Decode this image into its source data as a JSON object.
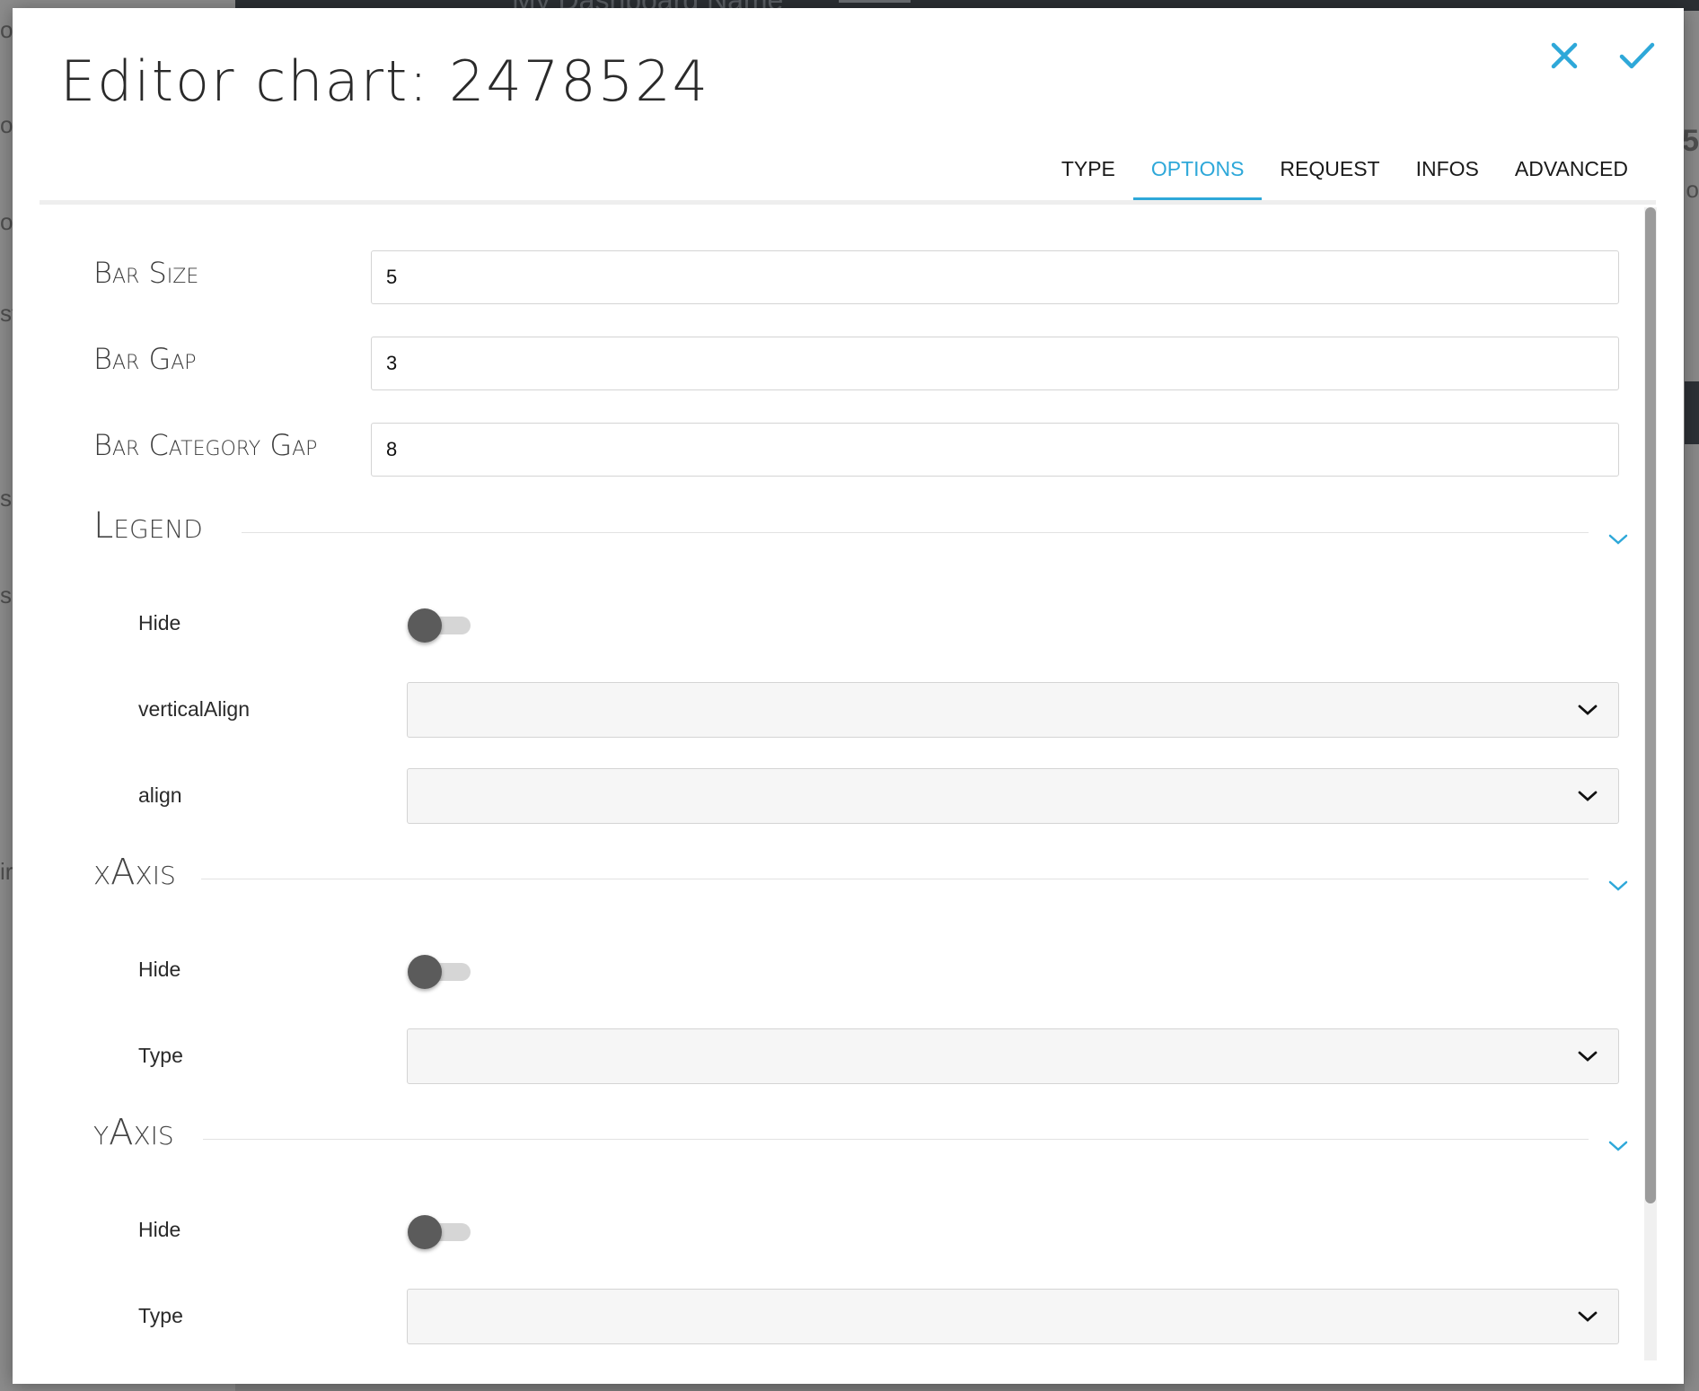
{
  "background": {
    "dashboard_title": "My Dashboard Name"
  },
  "modal": {
    "title": "Editor chart: 2478524",
    "close_icon": "close-icon",
    "confirm_icon": "check-icon",
    "accent_color": "#2ea8d9"
  },
  "tabs": [
    {
      "label": "TYPE",
      "active": false
    },
    {
      "label": "OPTIONS",
      "active": true
    },
    {
      "label": "REQUEST",
      "active": false
    },
    {
      "label": "INFOS",
      "active": false
    },
    {
      "label": "ADVANCED",
      "active": false
    }
  ],
  "fields": {
    "bar_size": {
      "label": "Bar Size",
      "value": "5"
    },
    "bar_gap": {
      "label": "Bar Gap",
      "value": "3"
    },
    "bar_category_gap": {
      "label": "Bar Category Gap",
      "value": "8"
    }
  },
  "sections": {
    "legend": {
      "title": "Legend",
      "hide_label": "Hide",
      "hide_on": false,
      "vertical_align_label": "verticalAlign",
      "vertical_align_value": "",
      "align_label": "align",
      "align_value": ""
    },
    "xaxis": {
      "title": "xAxis",
      "hide_label": "Hide",
      "hide_on": false,
      "type_label": "Type",
      "type_value": ""
    },
    "yaxis": {
      "title": "yAxis",
      "hide_label": "Hide",
      "hide_on": false,
      "type_label": "Type",
      "type_value": ""
    }
  }
}
